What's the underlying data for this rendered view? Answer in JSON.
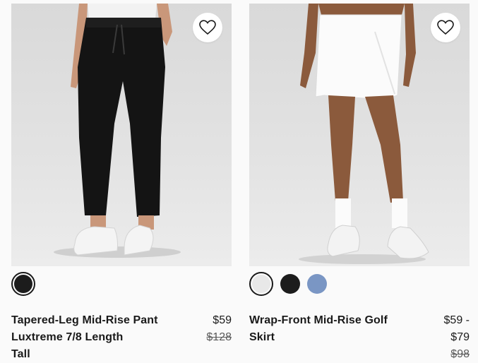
{
  "products": [
    {
      "name_lines": [
        "Tapered-Leg Mid-Rise Pant",
        "Luxtreme 7/8 Length",
        "Tall"
      ],
      "price": "$59",
      "original_price": "$128",
      "wishlist_icon": "heart-outline-icon",
      "swatches": [
        {
          "color": "#1c1c1c",
          "selected": true
        }
      ]
    },
    {
      "name_lines": [
        "Wrap-Front Mid-Rise Golf",
        "Skirt"
      ],
      "price_lines": [
        "$59 -",
        "$79"
      ],
      "original_price": "$98",
      "wishlist_icon": "heart-outline-icon",
      "swatches": [
        {
          "color": "#e8e8e8",
          "selected": true
        },
        {
          "color": "#1c1c1c",
          "selected": false
        },
        {
          "color": "#7a96c4",
          "selected": false
        }
      ]
    }
  ]
}
